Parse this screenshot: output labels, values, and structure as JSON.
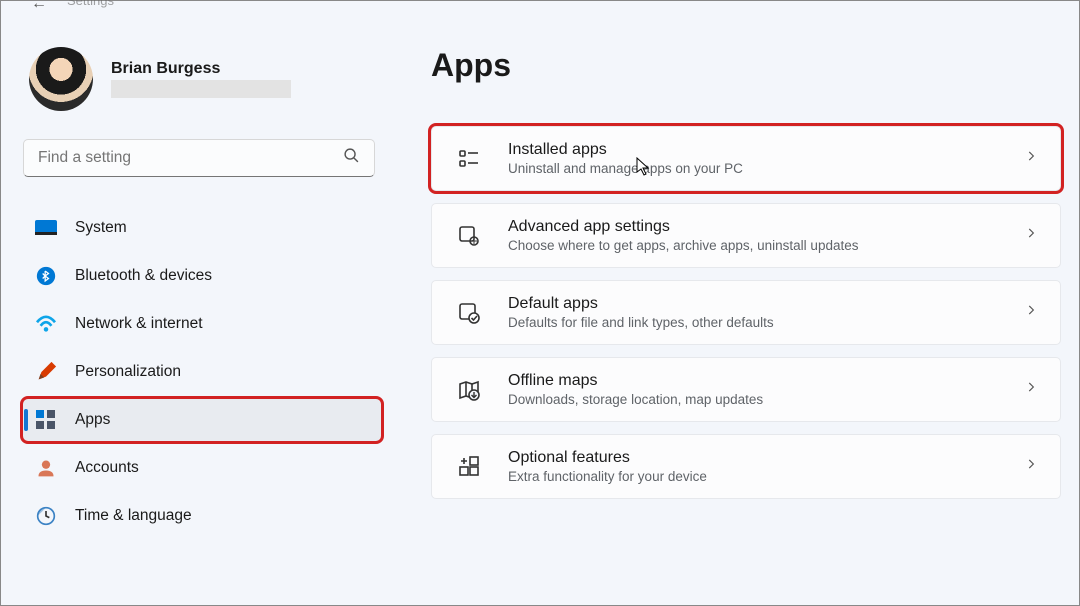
{
  "header": {
    "breadcrumb": "Settings"
  },
  "profile": {
    "name": "Brian Burgess"
  },
  "search": {
    "placeholder": "Find a setting"
  },
  "sidebar": {
    "items": [
      {
        "icon": "system",
        "label": "System"
      },
      {
        "icon": "bluetooth",
        "label": "Bluetooth & devices"
      },
      {
        "icon": "network",
        "label": "Network & internet"
      },
      {
        "icon": "personalization",
        "label": "Personalization"
      },
      {
        "icon": "apps",
        "label": "Apps",
        "selected": true
      },
      {
        "icon": "accounts",
        "label": "Accounts"
      },
      {
        "icon": "time",
        "label": "Time & language"
      }
    ]
  },
  "main": {
    "title": "Apps",
    "cards": [
      {
        "icon": "installed-apps",
        "title": "Installed apps",
        "sub": "Uninstall and manage apps on your PC",
        "highlighted": true
      },
      {
        "icon": "advanced-app",
        "title": "Advanced app settings",
        "sub": "Choose where to get apps, archive apps, uninstall updates"
      },
      {
        "icon": "default-apps",
        "title": "Default apps",
        "sub": "Defaults for file and link types, other defaults"
      },
      {
        "icon": "offline-maps",
        "title": "Offline maps",
        "sub": "Downloads, storage location, map updates"
      },
      {
        "icon": "optional-features",
        "title": "Optional features",
        "sub": "Extra functionality for your device"
      }
    ]
  }
}
